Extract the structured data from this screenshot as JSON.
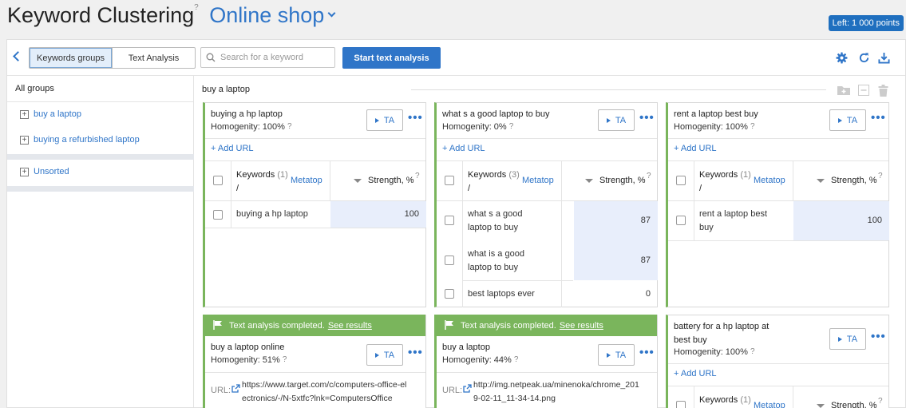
{
  "header": {
    "title": "Keyword Clustering",
    "help": "?",
    "project": "Online shop",
    "points": "Left: 1 000 points"
  },
  "toolbar": {
    "tab_groups": "Keywords groups",
    "tab_text": "Text Analysis",
    "search_placeholder": "Search for a keyword",
    "start_button": "Start text analysis"
  },
  "sidebar": {
    "all_groups": "All groups",
    "groups": [
      "buy a laptop",
      "buying a refurbished laptop"
    ],
    "unsorted": "Unsorted"
  },
  "group": {
    "name": "buy a laptop"
  },
  "table_header": {
    "keywords": "Keywords",
    "slash": "/",
    "metatop": "Metatop",
    "strength": "Strength, %",
    "help": "?"
  },
  "common": {
    "ta": "TA",
    "add_url": "+ Add URL",
    "url_label": "URL:",
    "completed": "Text analysis completed.",
    "see_results": "See results"
  },
  "cards": [
    {
      "title": "buying a hp laptop",
      "homogenity": "Homogenity: 100%",
      "count": "(1)",
      "rows": [
        {
          "kw": "buying a hp laptop",
          "s": "100"
        }
      ]
    },
    {
      "title": "what s a good laptop to buy",
      "homogenity": "Homogenity: 0%",
      "count": "(3)",
      "rows": [
        {
          "kw": "what s a good laptop to buy",
          "s": "87"
        },
        {
          "kw": "what is a good laptop to buy",
          "s": "87"
        },
        {
          "kw": "best laptops ever",
          "s": "0"
        }
      ]
    },
    {
      "title": "rent a laptop best buy",
      "homogenity": "Homogenity: 100%",
      "count": "(1)",
      "rows": [
        {
          "kw": "rent a laptop best buy",
          "s": "100"
        }
      ]
    },
    {
      "title": "buy a laptop online",
      "homogenity": "Homogenity: 51%",
      "url": "https://www.target.com/c/computers-office-electronics/-/N-5xtfc?lnk=ComputersOffice"
    },
    {
      "title": "buy a laptop",
      "homogenity": "Homogenity: 44%",
      "url": "http://img.netpeak.ua/minenoka/chrome_2019-02-11_11-34-14.png"
    },
    {
      "title": "battery for a hp laptop at best buy",
      "homogenity": "Homogenity: 100%",
      "count": "(1)"
    }
  ],
  "colors": {
    "accent": "#2f75c8",
    "green": "#7ab55c",
    "shade": "#e8eefb"
  }
}
